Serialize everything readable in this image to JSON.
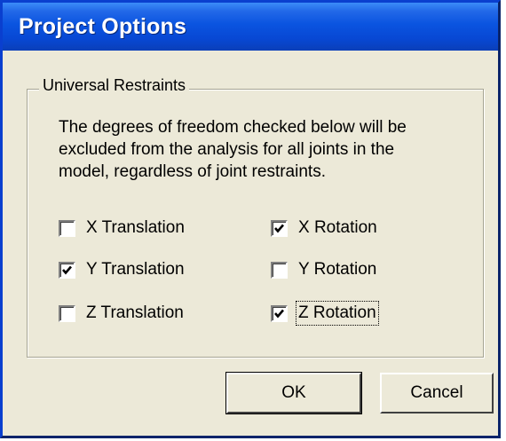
{
  "window": {
    "title": "Project Options"
  },
  "group": {
    "legend": "Universal Restraints",
    "description": "The degrees of freedom checked below will be excluded from the analysis for all joints in the model, regardless of joint restraints."
  },
  "checkboxes": [
    {
      "label": "X Translation",
      "checked": false
    },
    {
      "label": "X Rotation",
      "checked": true
    },
    {
      "label": "Y Translation",
      "checked": true
    },
    {
      "label": "Y Rotation",
      "checked": false
    },
    {
      "label": "Z Translation",
      "checked": false
    },
    {
      "label": "Z Rotation",
      "checked": true,
      "focused": true
    }
  ],
  "buttons": {
    "ok": "OK",
    "cancel": "Cancel"
  },
  "colors": {
    "titlebar": "#0a54e0",
    "face": "#ece9d8",
    "title_text": "#ffffff"
  }
}
